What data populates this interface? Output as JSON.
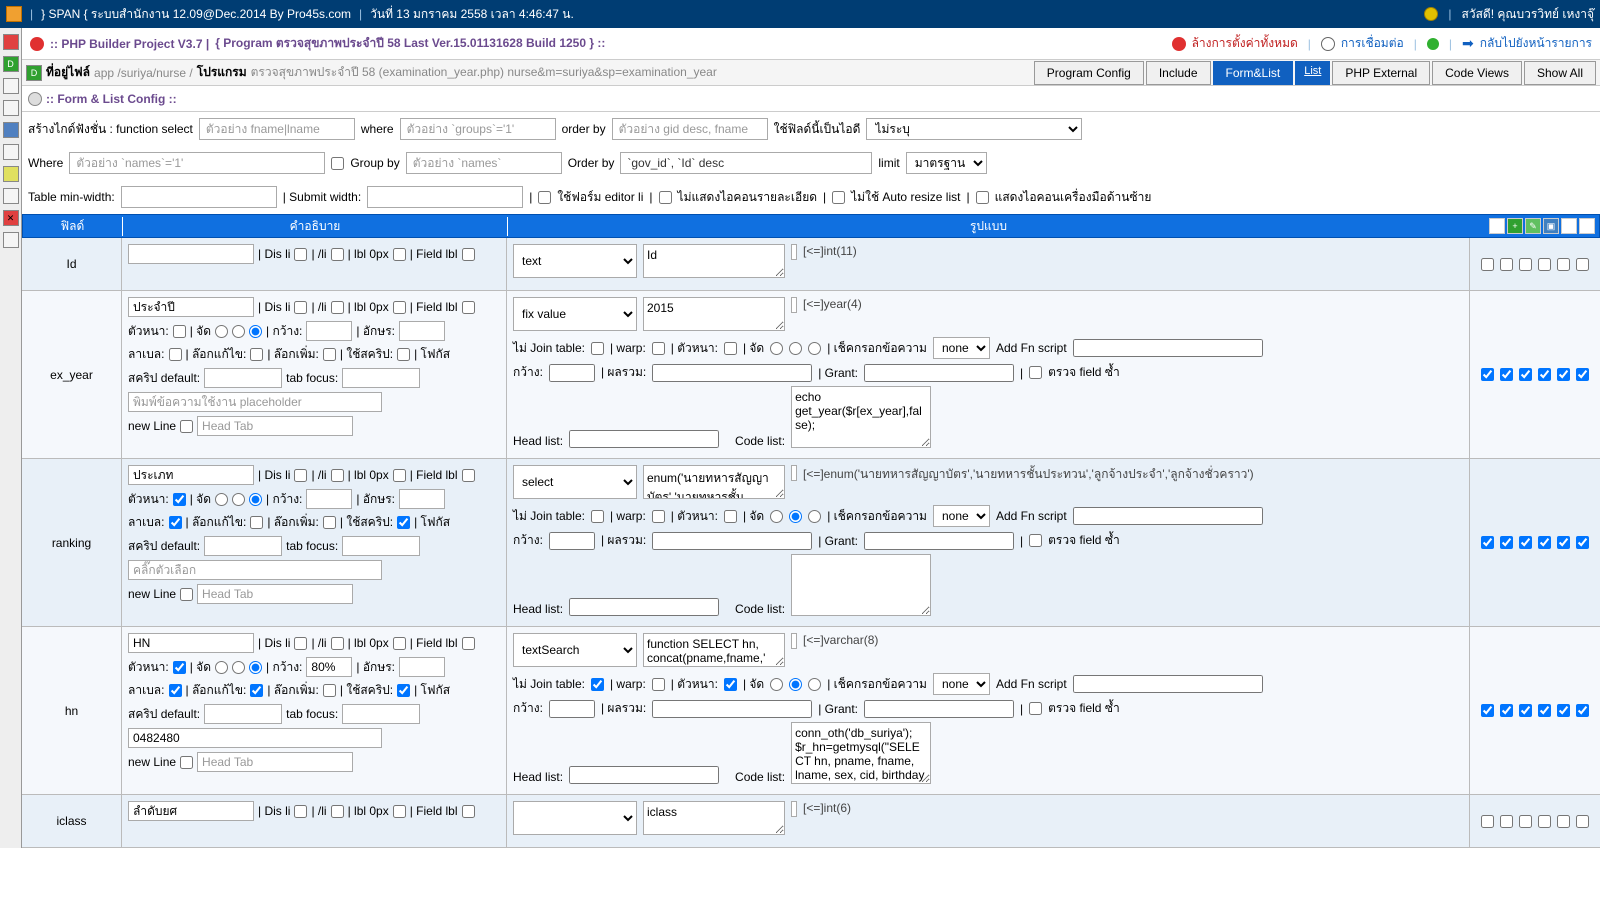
{
  "topbar": {
    "app_title": "} SPAN { ระบบสำนักงาน 12.09@Dec.2014 By Pro45s.com",
    "date_label": "วันที่ 13 มกราคม 2558 เวลา 4:46:47 น.",
    "greeting": "สวัสดี! คุณบวรวิทย์ เหงาจุ๊"
  },
  "title": {
    "prefix": ":: PHP Builder Project V3.7 |",
    "program": "{ Program ตรวจสุขภาพประจำปี 58 Last Ver.15.01131628 Build 1250 } ::",
    "clear_settings": "ล้างการตั้งค่าทั้งหมด",
    "connection": "การเชื่อมต่อ",
    "back": "กลับไปยังหน้ารายการ"
  },
  "path": {
    "label": "ที่อยู่ไฟล์",
    "p1": "app /suriya/nurse /",
    "p2": "โปรแกรม",
    "p3": "ตรวจสุขภาพประจำปี 58 (examination_year.php) nurse&m=suriya&sp=examination_year"
  },
  "tabs": {
    "program_config": "Program Config",
    "include": "Include",
    "form_list": "Form&List",
    "list": "List",
    "php_external": "PHP External",
    "code_views": "Code Views",
    "show_all": "Show All"
  },
  "section": ":: Form & List Config ::",
  "cfg": {
    "fn_select": "สร้างไกด์ฟังชั่น : function select",
    "fn_ph": "ตัวอย่าง fname|lname",
    "where": "where",
    "where_ph": "ตัวอย่าง `groups`='1'",
    "order_by": "order by",
    "order_ph": "ตัวอย่าง gid desc, fname",
    "id_field": "ใช้ฟิลด์นี้เป็นไอดี",
    "id_val": "ไม่ระบุ",
    "where2": "Where",
    "where2_ph": "ตัวอย่าง `names`='1'",
    "group_by": "Group by",
    "group_ph": "ตัวอย่าง `names`",
    "order_by2": "Order by",
    "order_val": "`gov_id`, `Id` desc",
    "limit": "limit",
    "limit_val": "มาตรฐาน",
    "min_width": "Table min-width:",
    "submit_width": "| Submit width:",
    "use_editor": "ใช้ฟอร์ม editor li",
    "no_detail_icon": "ไม่แสดงไอคอนรายละเอียด",
    "no_autoresize": "ไม่ใช้ Auto resize list",
    "show_tool_icon": "แสดงไอคอนเครื่องมือด้านซ้าย"
  },
  "headers": {
    "field": "ฟิลด์",
    "desc": "คำอธิบาย",
    "form": "รูปแบบ"
  },
  "common": {
    "dis_li": "| Dis li",
    "slash_li": "| /li",
    "lbl_0px": "| lbl 0px",
    "field_lbl": "| Field lbl",
    "bold": "ตัวหนา:",
    "align": "| จัด",
    "width": "| กว้าง:",
    "chars": "| อักษร:",
    "label": "ลาเบล:",
    "lock_edit": "| ล๊อกแก้ไข:",
    "lock_add": "| ล๊อกเพิ่ม:",
    "use_script": "| ใช้สคริป:",
    "focus": "| โฟกัส",
    "script_default": "สคริป default:",
    "tab_focus": "tab focus:",
    "placeholder_ph": "พิมพ์ข้อความใช้งาน placeholder",
    "new_line": "new Line",
    "head_tab_ph": "Head Tab",
    "no_join": "ไม่ Join table:",
    "warp": "| warp:",
    "bold2": "| ตัวหนา:",
    "align2": "| จัด",
    "check_input": "| เช็คกรอกข้อความ",
    "none": "none",
    "add_fn": "Add Fn script",
    "width2": "กว้าง:",
    "sum": "| ผลรวม:",
    "grant": "| Grant:",
    "dup_check": "ตรวจ field ซ้ำ",
    "head_list": "Head list:",
    "code_list": "Code list:"
  },
  "rows": [
    {
      "field": "Id",
      "desc_val": "",
      "type_sel": "text",
      "ta1": "Id",
      "meta": "[<=]int(11)",
      "script": "",
      "placeholder": ""
    },
    {
      "field": "ex_year",
      "desc_val": "ประจำปี",
      "type_sel": "fix value",
      "ta1": "2015",
      "meta": "[<=]year(4)",
      "script": "echo get_year($r[ex_year],false);",
      "placeholder": ""
    },
    {
      "field": "ranking",
      "desc_val": "ประเภท",
      "type_sel": "select",
      "ta1": "enum('นายทหารสัญญาบัตร','นายทหารชั้น",
      "meta": "[<=]enum('นายทหารสัญญาบัตร','นายทหารชั้นประทวน','ลูกจ้างประจำ','ลูกจ้างชั่วคราว')",
      "script": "",
      "placeholder": "คลิ๊กตัวเลือก"
    },
    {
      "field": "hn",
      "desc_val": "HN",
      "type_sel": "textSearch",
      "ta1": "function SELECT hn, concat(pname,fname,'",
      "meta": "[<=]varchar(8)",
      "script": "conn_oth('db_suriya'); $r_hn=getmysql(\"SELECT hn, pname, fname, lname, sex, cid, birthday",
      "placeholder": "0482480",
      "width_val": "80%"
    },
    {
      "field": "iclass",
      "desc_val": "ลำดับยศ",
      "type_sel": "",
      "ta1": "iclass",
      "meta": "[<=]int(6)",
      "script": "",
      "placeholder": ""
    }
  ]
}
